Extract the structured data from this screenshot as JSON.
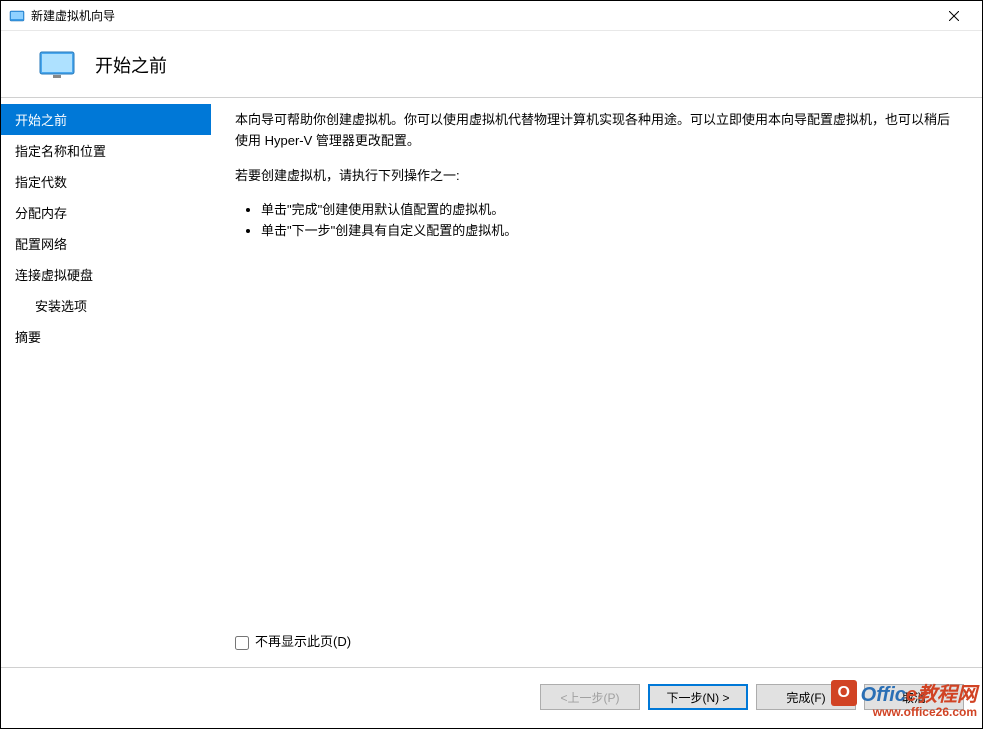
{
  "window": {
    "title": "新建虚拟机向导"
  },
  "header": {
    "title": "开始之前"
  },
  "sidebar": {
    "items": [
      {
        "label": "开始之前",
        "active": true
      },
      {
        "label": "指定名称和位置"
      },
      {
        "label": "指定代数"
      },
      {
        "label": "分配内存"
      },
      {
        "label": "配置网络"
      },
      {
        "label": "连接虚拟硬盘"
      },
      {
        "label": "安装选项",
        "indent": true
      },
      {
        "label": "摘要"
      }
    ]
  },
  "content": {
    "paragraph1": "本向导可帮助你创建虚拟机。你可以使用虚拟机代替物理计算机实现各种用途。可以立即使用本向导配置虚拟机，也可以稍后使用 Hyper-V 管理器更改配置。",
    "paragraph2": "若要创建虚拟机，请执行下列操作之一:",
    "bullet1": "单击\"完成\"创建使用默认值配置的虚拟机。",
    "bullet2": "单击\"下一步\"创建具有自定义配置的虚拟机。",
    "checkbox_label": "不再显示此页(D)"
  },
  "footer": {
    "prev": "<上一步(P)",
    "next": "下一步(N) >",
    "finish": "完成(F)",
    "cancel": "取消"
  },
  "watermark": {
    "brand_part1": "Offic",
    "brand_part2": "e教程网",
    "url": "www.office26.com"
  }
}
